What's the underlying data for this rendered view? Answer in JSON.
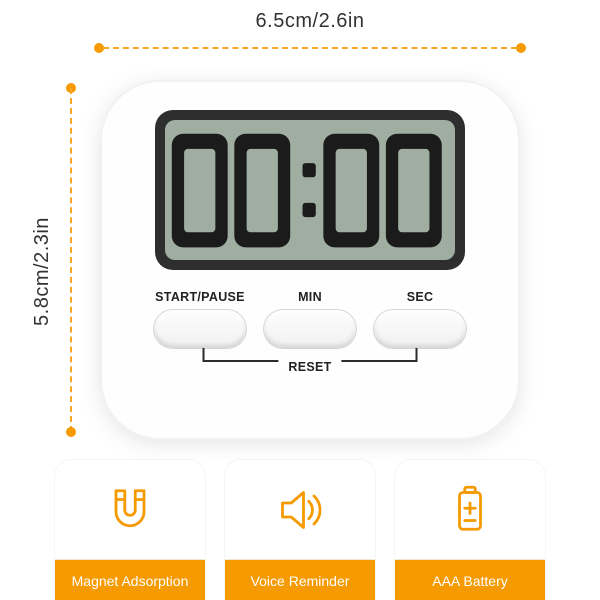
{
  "dimensions": {
    "width_label": "6.5cm/2.6in",
    "height_label": "5.8cm/2.3in"
  },
  "display": {
    "value": "00:00"
  },
  "buttons": {
    "start_pause": "START/PAUSE",
    "min": "MIN",
    "sec": "SEC",
    "reset": "RESET"
  },
  "features": [
    {
      "icon": "magnet-icon",
      "label": "Magnet Adsorption"
    },
    {
      "icon": "speaker-icon",
      "label": "Voice Reminder"
    },
    {
      "icon": "battery-icon",
      "label": "AAA Battery"
    }
  ],
  "colors": {
    "accent": "#f59a00"
  }
}
